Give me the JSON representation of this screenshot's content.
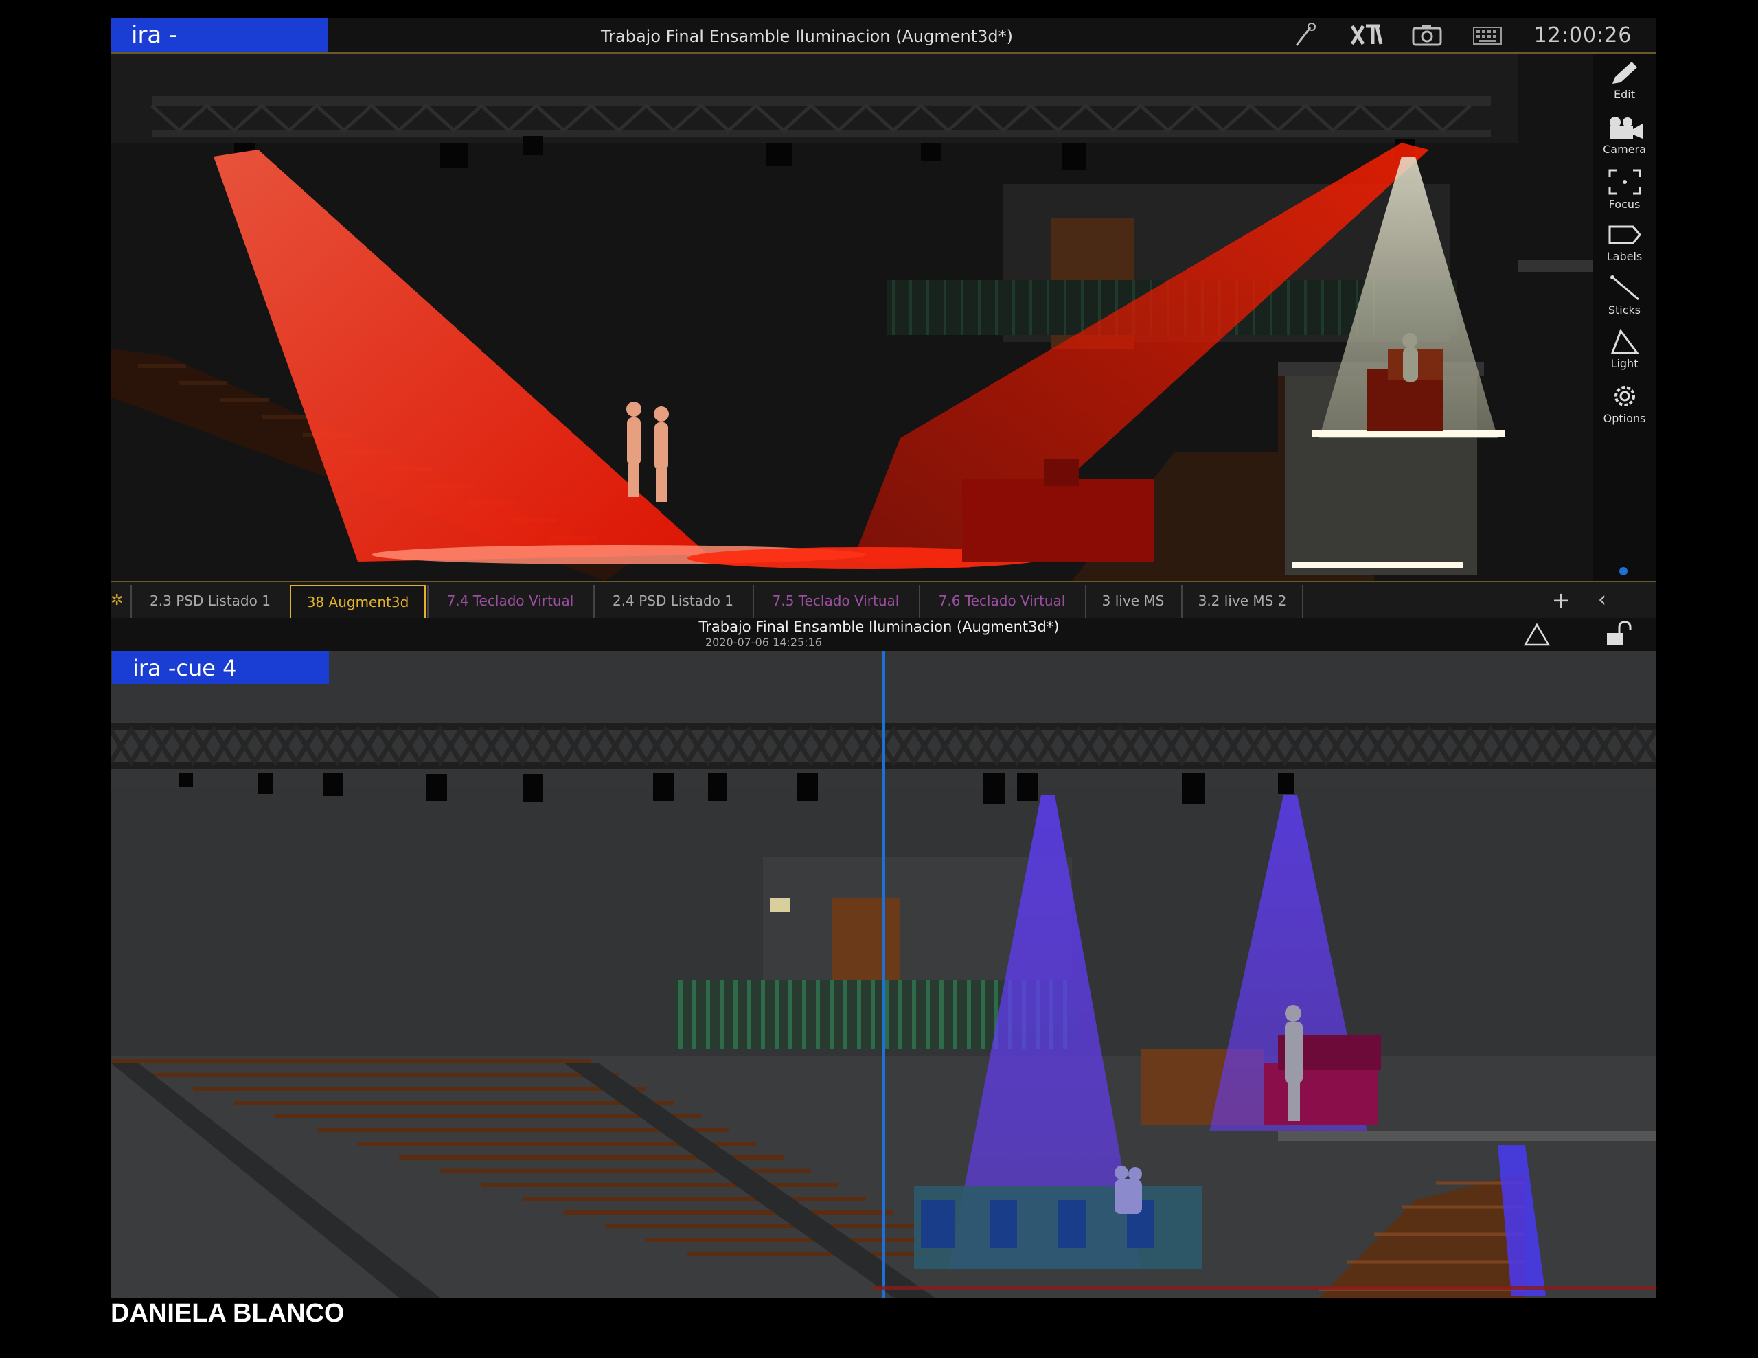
{
  "top_bar": {
    "cue_label": "ira -",
    "title": "Trabajo Final Ensamble Iluminacion (Augment3d*)",
    "clock": "12:00:26",
    "icons": [
      "wand-icon",
      "xt-logo-icon",
      "camera-snapshot-icon",
      "keyboard-icon"
    ]
  },
  "toolbar": {
    "tools": [
      {
        "label": "Edit",
        "icon": "pencil-icon"
      },
      {
        "label": "Camera",
        "icon": "video-camera-icon"
      },
      {
        "label": "Focus",
        "icon": "focus-brackets-icon"
      },
      {
        "label": "Labels",
        "icon": "tag-icon"
      },
      {
        "label": "Sticks",
        "icon": "stick-icon"
      },
      {
        "label": "Light",
        "icon": "light-cone-icon"
      },
      {
        "label": "Options",
        "icon": "gear-icon"
      }
    ]
  },
  "tabs": [
    {
      "label": "2.3 PSD Listado 1",
      "state": "normal"
    },
    {
      "label": "38 Augment3d",
      "state": "active"
    },
    {
      "label": "7.4 Teclado Virtual",
      "state": "purple"
    },
    {
      "label": "2.4 PSD Listado 1",
      "state": "normal"
    },
    {
      "label": "7.5 Teclado Virtual",
      "state": "purple"
    },
    {
      "label": "7.6 Teclado Virtual",
      "state": "purple"
    },
    {
      "label": "3 live MS",
      "state": "normal"
    },
    {
      "label": "3.2 live MS 2",
      "state": "normal"
    }
  ],
  "info_strip": {
    "title": "Trabajo Final Ensamble Iluminacion (Augment3d*)",
    "date": "2020-07-06 14:25:16"
  },
  "bottom_view": {
    "cue_label": "ira -cue  4"
  },
  "footer": {
    "author": "DANIELA BLANCO"
  },
  "colors": {
    "cue_label_bg": "#1a3ed3",
    "active_tab": "#e5b32b",
    "purple_tab": "#9c4fa0",
    "red_beam": "#ff2a10",
    "white_beam": "#d8d6c0",
    "violet_beam": "#6a3cff"
  }
}
